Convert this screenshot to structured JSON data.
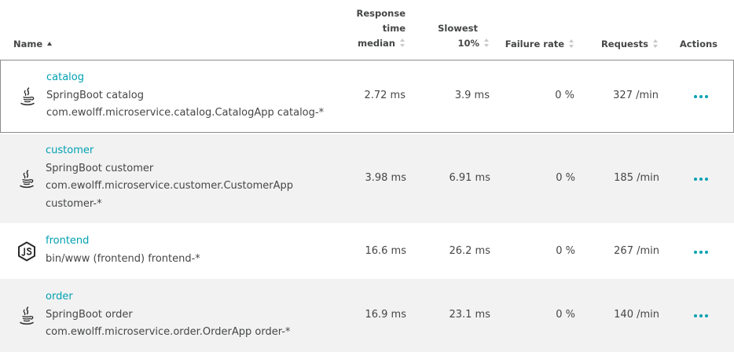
{
  "columns": {
    "name": "Name",
    "response_line1": "Response",
    "response_line2": "time",
    "response_line3": "median",
    "slowest_line1": "Slowest",
    "slowest_line2": "10%",
    "failure": "Failure rate",
    "requests": "Requests",
    "actions": "Actions"
  },
  "rows": [
    {
      "name": "catalog",
      "lines": [
        "SpringBoot catalog",
        "com.ewolff.microservice.catalog.CatalogApp catalog-*"
      ],
      "icon": "java-icon",
      "response": "2.72 ms",
      "slowest": "3.9 ms",
      "failure": "0 %",
      "requests": "327 /min"
    },
    {
      "name": "customer",
      "lines": [
        "SpringBoot customer",
        "com.ewolff.microservice.customer.CustomerApp",
        "customer-*"
      ],
      "icon": "java-icon",
      "response": "3.98 ms",
      "slowest": "6.91 ms",
      "failure": "0 %",
      "requests": "185 /min"
    },
    {
      "name": "frontend",
      "lines": [
        "bin/www (frontend) frontend-*"
      ],
      "icon": "nodejs-icon",
      "response": "16.6 ms",
      "slowest": "26.2 ms",
      "failure": "0 %",
      "requests": "267 /min"
    },
    {
      "name": "order",
      "lines": [
        "SpringBoot order",
        "com.ewolff.microservice.order.OrderApp order-*"
      ],
      "icon": "java-icon",
      "response": "16.9 ms",
      "slowest": "23.1 ms",
      "failure": "0 %",
      "requests": "140 /min"
    }
  ],
  "colors": {
    "link": "#00a1b2",
    "text": "#454646",
    "alt_row": "#f2f2f2",
    "selected_border": "#8c8c8c"
  }
}
